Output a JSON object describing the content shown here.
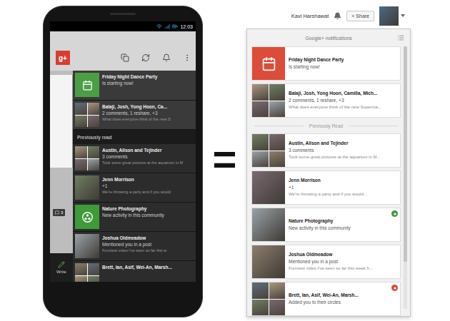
{
  "phone": {
    "status_bar": {
      "time": "12:03"
    },
    "app_bar": {
      "logo": "g+"
    },
    "side_panel": {
      "comment_count": "3",
      "write": "Write"
    },
    "new": [
      {
        "kind": "event",
        "title": "Friday Night Dance Party",
        "subtitle": "Is starting now!"
      },
      {
        "kind": "group",
        "title": "Balaji, Josh, Yong Hoon, Ca...",
        "subtitle": "2 comments, 1 reshare, +3",
        "snippet": "What does everyone think of the new S"
      }
    ],
    "previously_read": "Previously read",
    "earlier": [
      {
        "kind": "group",
        "title": "Austin, Alison and Tejinder",
        "subtitle": "3 comments",
        "snippet": "Took some great pictures at the aquarium in M"
      },
      {
        "kind": "photo",
        "title": "Jenn Morrison",
        "subtitle": "+1",
        "snippet": "We're throwing a party and if you would"
      },
      {
        "kind": "community",
        "title": "Nature Photography",
        "subtitle": "New activity in this community"
      },
      {
        "kind": "photo",
        "title": "Joshua Oldmeadow",
        "subtitle": "Mentioned you in a post",
        "snippet": "Funniest video I've seen so far this w"
      },
      {
        "kind": "group",
        "title": "Brett, Ian, Asif, Wei-An, Marsh..."
      }
    ]
  },
  "equals": "=",
  "web": {
    "user": "Kavi Harshawat",
    "share": "+ Share",
    "panel_title": "Google+ notifications",
    "new": [
      {
        "kind": "event",
        "title": "Friday Night Dance Party",
        "subtitle": "Is starting now!"
      },
      {
        "kind": "group",
        "title": "Balaji, Josh, Yong Hoon, Camilla, Mich...",
        "subtitle": "2 comments, 1 reshare, +3",
        "snippet": "What does everyone think of the new Superma..."
      }
    ],
    "previously_read": "Previously Read",
    "earlier": [
      {
        "kind": "group",
        "title": "Austin, Alison and Tejinder",
        "subtitle": "3 comments",
        "snippet": "Took some great pictures at the aquarium in M..."
      },
      {
        "kind": "photo",
        "title": "Jenn Morrison",
        "subtitle": "+1",
        "snippet": "We're throwing a party and if you would..."
      },
      {
        "kind": "photo",
        "title": "Nature Photography",
        "subtitle": "New activity in this community",
        "color": "#3d9a3b"
      },
      {
        "kind": "photo",
        "title": "Joshua Oldmeadow",
        "subtitle": "Mentioned you in a post",
        "snippet": "Funniest video I've seen so far this week h..."
      },
      {
        "kind": "group",
        "title": "Brett, Ian, Asif, Wei-An, Marsh...",
        "subtitle": "Added you to their circles",
        "color": "#dd4b39"
      }
    ]
  }
}
